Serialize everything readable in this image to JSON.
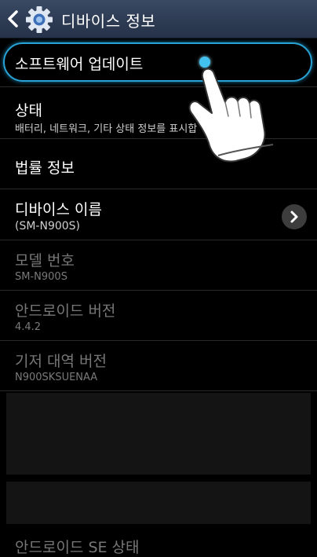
{
  "header": {
    "title": "디바이스 정보",
    "back_icon": "back-arrow-icon",
    "settings_icon": "gear-icon"
  },
  "items": [
    {
      "primary": "소프트웨어 업데이트"
    },
    {
      "primary": "상태",
      "secondary": "배터리, 네트워크, 기타 상태 정보를 표시합"
    },
    {
      "primary": "법률 정보"
    },
    {
      "primary": "디바이스 이름",
      "secondary": "(SM-N900S)"
    },
    {
      "primary": "모델 번호",
      "secondary": "SM-N900S"
    },
    {
      "primary": "안드로이드 버전",
      "secondary": "4.4.2"
    },
    {
      "primary": "기저 대역 버전",
      "secondary": "N900SKSUENAA"
    },
    {
      "primary": "안드로이드 SE 상태"
    }
  ],
  "colors": {
    "accent": "#28a3d6",
    "header_bg": "#2c3a52",
    "background": "#000000",
    "disabled_text": "#777777"
  }
}
